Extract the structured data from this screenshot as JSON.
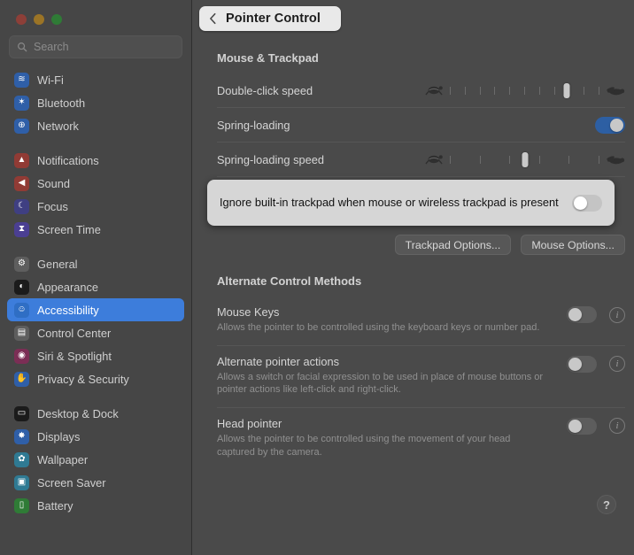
{
  "window": {
    "traffic_lights": [
      "close",
      "minimize",
      "zoom"
    ]
  },
  "sidebar": {
    "search": {
      "placeholder": "Search",
      "value": ""
    },
    "groups": [
      {
        "items": [
          {
            "label": "Wi-Fi",
            "icon": "wifi-icon",
            "color": "#2f5fa8",
            "glyph": "≋",
            "selected": false
          },
          {
            "label": "Bluetooth",
            "icon": "bluetooth-icon",
            "color": "#2f5fa8",
            "glyph": "✶",
            "selected": false
          },
          {
            "label": "Network",
            "icon": "network-icon",
            "color": "#2f5fa8",
            "glyph": "⊕",
            "selected": false
          }
        ]
      },
      {
        "items": [
          {
            "label": "Notifications",
            "icon": "notifications-icon",
            "color": "#913b35",
            "glyph": "▲",
            "selected": false
          },
          {
            "label": "Sound",
            "icon": "sound-icon",
            "color": "#913b35",
            "glyph": "◀",
            "selected": false
          },
          {
            "label": "Focus",
            "icon": "focus-icon",
            "color": "#3f3f82",
            "glyph": "☾",
            "selected": false
          },
          {
            "label": "Screen Time",
            "icon": "screen-time-icon",
            "color": "#4b3f93",
            "glyph": "⧗",
            "selected": false
          }
        ]
      },
      {
        "items": [
          {
            "label": "General",
            "icon": "general-icon",
            "color": "#5e5e5e",
            "glyph": "⚙",
            "selected": false
          },
          {
            "label": "Appearance",
            "icon": "appearance-icon",
            "color": "#1b1b1b",
            "glyph": "◐",
            "selected": false
          },
          {
            "label": "Accessibility",
            "icon": "accessibility-icon",
            "color": "#2f6ec4",
            "glyph": "☺",
            "selected": true
          },
          {
            "label": "Control Center",
            "icon": "control-center-icon",
            "color": "#5e5e5e",
            "glyph": "▤",
            "selected": false
          },
          {
            "label": "Siri & Spotlight",
            "icon": "siri-icon",
            "color": "#7b2e55",
            "glyph": "◉",
            "selected": false
          },
          {
            "label": "Privacy & Security",
            "icon": "privacy-icon",
            "color": "#2f5fa8",
            "glyph": "✋",
            "selected": false
          }
        ]
      },
      {
        "items": [
          {
            "label": "Desktop & Dock",
            "icon": "desktop-dock-icon",
            "color": "#1b1b1b",
            "glyph": "▭",
            "selected": false
          },
          {
            "label": "Displays",
            "icon": "displays-icon",
            "color": "#2f5fa8",
            "glyph": "✸",
            "selected": false
          },
          {
            "label": "Wallpaper",
            "icon": "wallpaper-icon",
            "color": "#2f7a93",
            "glyph": "✿",
            "selected": false
          },
          {
            "label": "Screen Saver",
            "icon": "screen-saver-icon",
            "color": "#2f7a93",
            "glyph": "▣",
            "selected": false
          },
          {
            "label": "Battery",
            "icon": "battery-icon",
            "color": "#2f7b36",
            "glyph": "▯",
            "selected": false
          }
        ]
      }
    ]
  },
  "header": {
    "back_label": "Pointer Control",
    "back_icon": "chevron-left-icon"
  },
  "mouse_trackpad": {
    "section_title": "Mouse & Trackpad",
    "double_click": {
      "label": "Double-click speed",
      "left_icon": "turtle-icon",
      "right_icon": "rabbit-icon",
      "ticks": 11,
      "value_percent": 78
    },
    "spring_loading": {
      "label": "Spring-loading",
      "toggle_state": "on"
    },
    "spring_loading_speed": {
      "label": "Spring-loading speed",
      "left_icon": "turtle-icon",
      "right_icon": "rabbit-icon",
      "ticks": 6,
      "value_percent": 50
    },
    "buttons": [
      {
        "label": "Trackpad Options...",
        "name": "trackpad-options-button"
      },
      {
        "label": "Mouse Options...",
        "name": "mouse-options-button"
      }
    ]
  },
  "spotlight": {
    "label": "Ignore built-in trackpad when mouse or wireless trackpad is present",
    "toggle_state": "off"
  },
  "alternate_control": {
    "section_title": "Alternate Control Methods",
    "rows": [
      {
        "title": "Mouse Keys",
        "description": "Allows the pointer to be controlled using the keyboard keys or number pad.",
        "toggle_state": "off",
        "info_label": "i"
      },
      {
        "title": "Alternate pointer actions",
        "description": "Allows a switch or facial expression to be used in place of mouse buttons or pointer actions like left-click and right-click.",
        "toggle_state": "off",
        "info_label": "i"
      },
      {
        "title": "Head pointer",
        "description": "Allows the pointer to be controlled using the movement of your head captured by the camera.",
        "toggle_state": "off",
        "info_label": "i"
      }
    ]
  },
  "help": {
    "label": "?"
  },
  "colors": {
    "accent_blue": "#3d7ddb",
    "toggle_on": "#2d5fa3",
    "spotlight_bg": "#d6d6d6",
    "window_bg": "#4a4a4a",
    "sidebar_bg": "#464646"
  }
}
